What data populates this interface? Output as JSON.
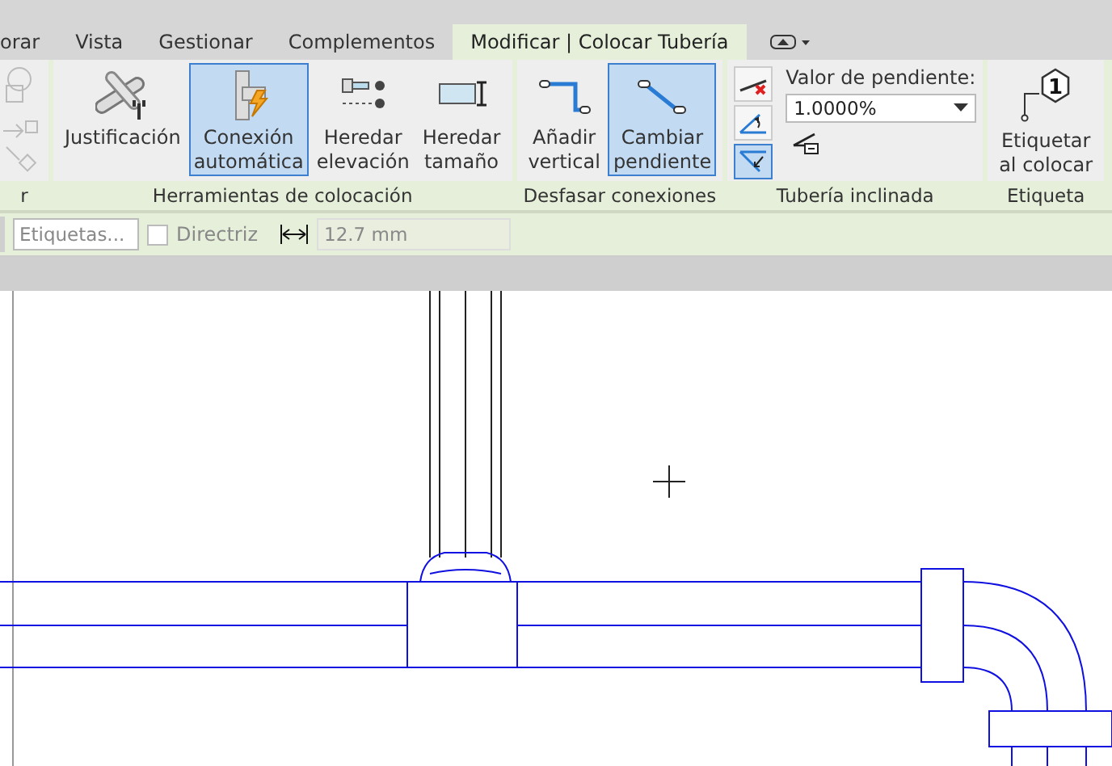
{
  "tabs": [
    {
      "label": "orar",
      "selected": false
    },
    {
      "label": "Vista",
      "selected": false
    },
    {
      "label": "Gestionar",
      "selected": false
    },
    {
      "label": "Complementos",
      "selected": false
    },
    {
      "label": "Modificar | Colocar Tubería",
      "selected": true
    }
  ],
  "ribbon": {
    "cut_panel_label": "r",
    "panels": [
      {
        "label": "Herramientas de colocación",
        "tools": [
          {
            "kind": "justify",
            "lines": [
              "Justificación"
            ],
            "selected": false
          },
          {
            "kind": "autoconnect",
            "lines": [
              "Conexión",
              "automática"
            ],
            "selected": true
          },
          {
            "kind": "inherit-elevation",
            "lines": [
              "Heredar",
              "elevación"
            ],
            "selected": false
          },
          {
            "kind": "inherit-size",
            "lines": [
              "Heredar",
              "tamaño"
            ],
            "selected": false
          }
        ]
      },
      {
        "label": "Desfasar conexiones",
        "tools": [
          {
            "kind": "add-vertical",
            "lines": [
              "Añadir",
              "vertical"
            ],
            "selected": false
          },
          {
            "kind": "change-slope",
            "lines": [
              "Cambiar",
              "pendiente"
            ],
            "selected": true
          }
        ]
      }
    ],
    "slope_panel": {
      "label": "Tubería inclinada",
      "small_buttons": [
        {
          "kind": "no-slope",
          "selected": false
        },
        {
          "kind": "slope-up",
          "selected": false
        },
        {
          "kind": "slope-down",
          "selected": true
        }
      ],
      "value_label": "Valor de pendiente:",
      "value": "1.0000%"
    },
    "tag_panel": {
      "label": "Etiqueta",
      "lines": [
        "Etiquetar",
        "al colocar"
      ],
      "tag_number": "1"
    }
  },
  "options_bar": {
    "tags_placeholder": "Etiquetas...",
    "leader": {
      "label": "Directriz",
      "checked": false
    },
    "length": "12.7 mm"
  }
}
